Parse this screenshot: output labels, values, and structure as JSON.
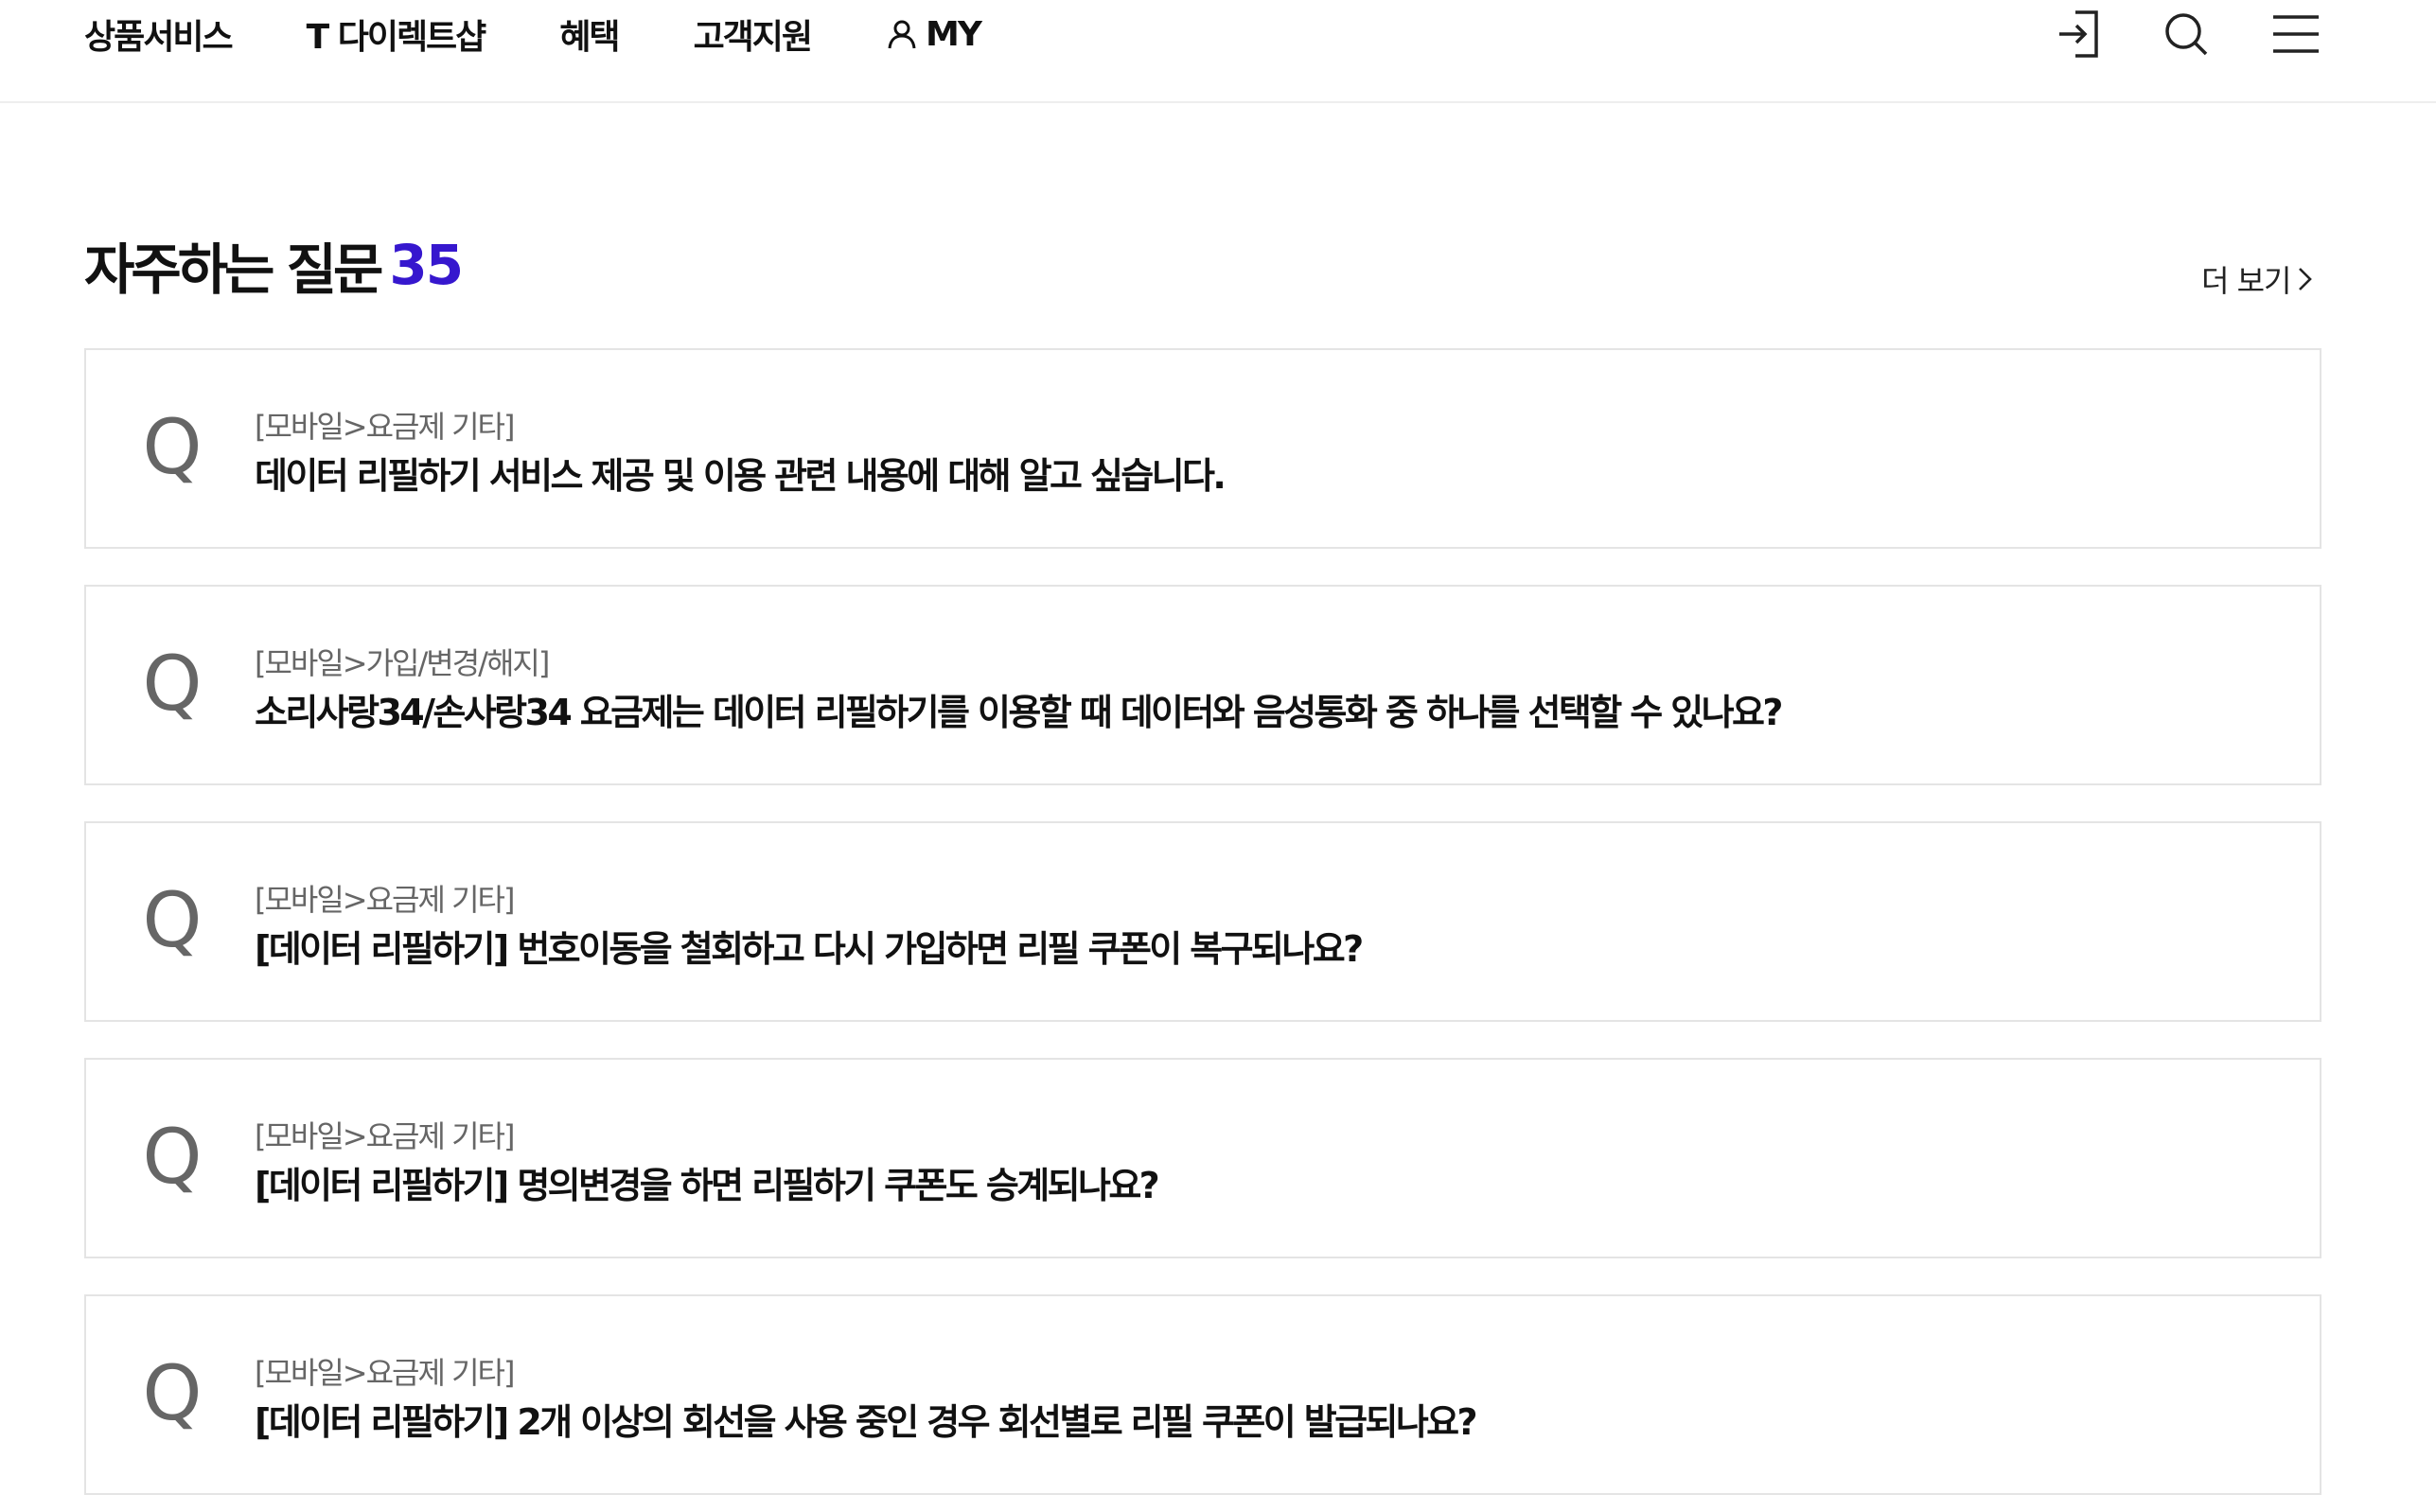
{
  "header": {
    "menu": [
      "상품서비스",
      "T 다이렉트샵",
      "혜택",
      "고객지원",
      "MY"
    ],
    "icons": [
      "login-icon",
      "search-icon",
      "menu-icon"
    ]
  },
  "faq": {
    "title": "자주하는 질문",
    "count": "35",
    "more_label": "더 보기",
    "items": [
      {
        "category": "[모바일>요금제 기타]",
        "question": "데이터 리필하기 서비스 제공 및 이용 관련 내용에 대해 알고 싶습니다."
      },
      {
        "category": "[모바일>가입/변경/해지]",
        "question": "소리사랑34/손사랑34 요금제는 데이터 리필하기를 이용할 때 데이터와 음성통화 중 하나를 선택할 수 있나요?"
      },
      {
        "category": "[모바일>요금제 기타]",
        "question": "[데이터 리필하기] 번호이동을 철회하고 다시 가입하면 리필 쿠폰이 복구되나요?"
      },
      {
        "category": "[모바일>요금제 기타]",
        "question": "[데이터 리필하기] 명의변경을 하면 리필하기 쿠폰도 승계되나요?"
      },
      {
        "category": "[모바일>요금제 기타]",
        "question": "[데이터 리필하기] 2개 이상의 회선을 사용 중인 경우 회선별로 리필 쿠폰이 발급되나요?"
      }
    ]
  },
  "q_mark": "Q",
  "colors": {
    "accent": "#3617ce",
    "text": "#111111",
    "muted": "#666666",
    "border": "#e4e4e4"
  }
}
